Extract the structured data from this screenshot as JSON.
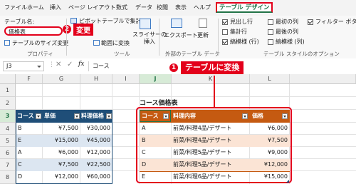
{
  "tabs": [
    "ファイル",
    "ホーム",
    "挿入",
    "ページ レイアウト",
    "数式",
    "データ",
    "校閲",
    "表示",
    "ヘルプ"
  ],
  "active_tab": "テーブル デザイン",
  "ribbon": {
    "table_name_label": "テーブル名:",
    "table_name_value": "価格表",
    "resize_label": "テーブルのサイズ変更",
    "group_properties": "プロパティ",
    "pivot_label": "ピボットテーブルで集計",
    "convert_range_label": "範囲に変換",
    "slicer_label": "スライサーの\n挿入",
    "group_tools": "ツール",
    "export_label": "エクスポート",
    "refresh_label": "更新",
    "group_external": "外部のテーブル データ",
    "options": [
      {
        "label": "見出し行",
        "checked": true
      },
      {
        "label": "集計行",
        "checked": false
      },
      {
        "label": "縞模様 (行)",
        "checked": true
      },
      {
        "label": "最初の列",
        "checked": false
      },
      {
        "label": "最後の列",
        "checked": false
      },
      {
        "label": "縞模様 (列)",
        "checked": false
      },
      {
        "label": "フィルター ボタン",
        "checked": true
      }
    ],
    "group_style_options": "テーブル スタイルのオプション"
  },
  "annotations": {
    "step1_num": "1",
    "step1_text": "テーブルに変換",
    "step2_num": "2",
    "step2_text": "変更"
  },
  "formula_bar": {
    "name_box": "J3",
    "fx": "fx",
    "value": "コース"
  },
  "columns": [
    "F",
    "G",
    "H",
    "I",
    "J",
    "K",
    "L"
  ],
  "rows": [
    "1",
    "2",
    "3",
    "4",
    "5",
    "6",
    "7",
    "8"
  ],
  "sheet_title": "コース価格表",
  "left_table": {
    "headers": [
      "コース",
      "単価",
      "料理価格"
    ],
    "rows": [
      [
        "B",
        "¥7,500",
        "¥30,000"
      ],
      [
        "E",
        "¥15,000",
        "¥45,000"
      ],
      [
        "A",
        "¥6,000",
        "¥12,000"
      ],
      [
        "C",
        "¥7,500",
        "¥22,500"
      ],
      [
        "D",
        "¥12,000",
        "¥60,000"
      ]
    ]
  },
  "right_table": {
    "headers": [
      "コース",
      "料理内容",
      "価格"
    ],
    "rows": [
      [
        "A",
        "前菜/料理4品/デザート",
        "¥6,000"
      ],
      [
        "B",
        "前菜/料理4品/デザート",
        "¥7,500"
      ],
      [
        "C",
        "前菜/料理5品/デザート",
        "¥9,000"
      ],
      [
        "D",
        "前菜/料理5品/デザート",
        "¥12,000"
      ],
      [
        "E",
        "前菜/料理6品/デザート",
        "¥15,000"
      ]
    ]
  },
  "colors": {
    "accent_red": "#e3001b",
    "excel_green": "#217346",
    "header_blue": "#1f4e78",
    "header_orange": "#c55a11",
    "band_orange": "#fbe4d5"
  }
}
